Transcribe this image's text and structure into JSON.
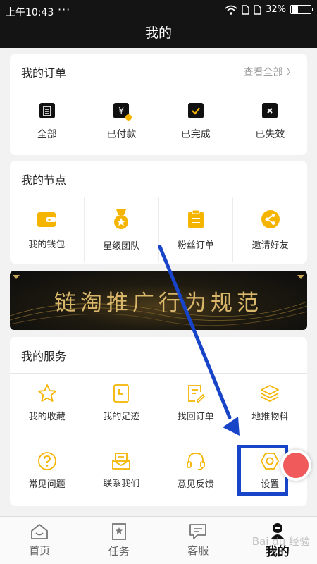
{
  "status": {
    "time": "上午10:43",
    "dots": "···",
    "battery": "32%",
    "battery_level": 0.32
  },
  "title": "我的",
  "orders": {
    "title": "我的订单",
    "more": "查看全部 〉",
    "items": [
      {
        "label": "全部",
        "icon": "clipboard-icon"
      },
      {
        "label": "已付款",
        "icon": "yen-icon"
      },
      {
        "label": "已完成",
        "icon": "check-icon"
      },
      {
        "label": "已失效",
        "icon": "x-icon"
      }
    ]
  },
  "nodes": {
    "title": "我的节点",
    "items": [
      {
        "label": "我的钱包",
        "icon": "wallet-icon"
      },
      {
        "label": "星级团队",
        "icon": "medal-icon"
      },
      {
        "label": "粉丝订单",
        "icon": "order-list-icon"
      },
      {
        "label": "邀请好友",
        "icon": "share-icon"
      }
    ]
  },
  "banner": {
    "text": "链淘推广行为规范"
  },
  "services": {
    "title": "我的服务",
    "items": [
      {
        "label": "我的收藏",
        "icon": "star-icon"
      },
      {
        "label": "我的足迹",
        "icon": "bookmark-icon"
      },
      {
        "label": "找回订单",
        "icon": "edit-doc-icon"
      },
      {
        "label": "地推物料",
        "icon": "layers-icon"
      },
      {
        "label": "常见问题",
        "icon": "question-icon"
      },
      {
        "label": "联系我们",
        "icon": "mailbox-icon"
      },
      {
        "label": "意见反馈",
        "icon": "headset-icon"
      },
      {
        "label": "设置",
        "icon": "settings-hex-icon"
      }
    ]
  },
  "tabs": [
    {
      "label": "首页",
      "icon": "home-icon"
    },
    {
      "label": "任务",
      "icon": "task-icon"
    },
    {
      "label": "客服",
      "icon": "chat-icon"
    },
    {
      "label": "我的",
      "icon": "avatar-icon"
    }
  ],
  "watermark": "Bai du 经验",
  "colors": {
    "accent": "#f5b400",
    "annotation": "#1844c8",
    "header": "#141414"
  }
}
